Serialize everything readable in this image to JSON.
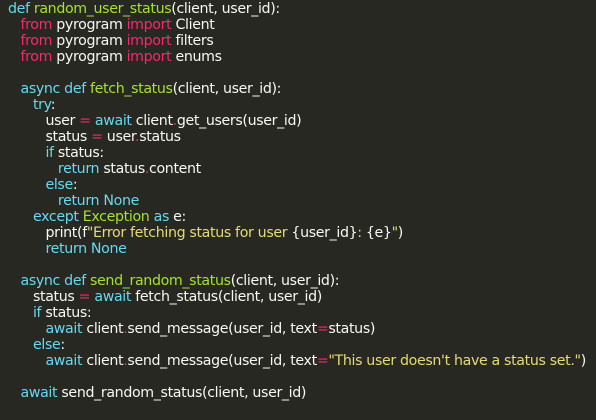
{
  "colors": {
    "background": "#272822",
    "plain": "#f8f8f2",
    "keyword": "#66d9ef",
    "import_keyword": "#f92672",
    "function_name": "#a6e22e",
    "operator": "#f92672",
    "string": "#e6db74"
  },
  "code": {
    "lines": [
      [
        [
          "kw",
          "def "
        ],
        [
          "fn",
          "random_user_status"
        ],
        [
          "plain",
          "(client, user_id):"
        ]
      ],
      [
        [
          "plain",
          "   "
        ],
        [
          "imp",
          "from"
        ],
        [
          "plain",
          " pyrogram "
        ],
        [
          "imp",
          "import"
        ],
        [
          "plain",
          " Client"
        ]
      ],
      [
        [
          "plain",
          "   "
        ],
        [
          "imp",
          "from"
        ],
        [
          "plain",
          " pyrogram "
        ],
        [
          "imp",
          "import"
        ],
        [
          "plain",
          " filters"
        ]
      ],
      [
        [
          "plain",
          "   "
        ],
        [
          "imp",
          "from"
        ],
        [
          "plain",
          " pyrogram "
        ],
        [
          "imp",
          "import"
        ],
        [
          "plain",
          " enums"
        ]
      ],
      [],
      [
        [
          "plain",
          "   "
        ],
        [
          "kw",
          "async def "
        ],
        [
          "fn",
          "fetch_status"
        ],
        [
          "plain",
          "(client, user_id):"
        ]
      ],
      [
        [
          "plain",
          "      "
        ],
        [
          "kw",
          "try"
        ],
        [
          "plain",
          ":"
        ]
      ],
      [
        [
          "plain",
          "         user "
        ],
        [
          "op",
          "="
        ],
        [
          "plain",
          " "
        ],
        [
          "kw",
          "await"
        ],
        [
          "plain",
          " client"
        ],
        [
          "op",
          "."
        ],
        [
          "plain",
          "get_users(user_id)"
        ]
      ],
      [
        [
          "plain",
          "         status "
        ],
        [
          "op",
          "="
        ],
        [
          "plain",
          " user"
        ],
        [
          "op",
          "."
        ],
        [
          "plain",
          "status"
        ]
      ],
      [
        [
          "plain",
          "         "
        ],
        [
          "kw",
          "if"
        ],
        [
          "plain",
          " status:"
        ]
      ],
      [
        [
          "plain",
          "            "
        ],
        [
          "kw",
          "return"
        ],
        [
          "plain",
          " status"
        ],
        [
          "op",
          "."
        ],
        [
          "plain",
          "content"
        ]
      ],
      [
        [
          "plain",
          "         "
        ],
        [
          "kw",
          "else"
        ],
        [
          "plain",
          ":"
        ]
      ],
      [
        [
          "plain",
          "            "
        ],
        [
          "kw",
          "return None"
        ]
      ],
      [
        [
          "plain",
          "      "
        ],
        [
          "kw",
          "except"
        ],
        [
          "plain",
          " "
        ],
        [
          "fn",
          "Exception"
        ],
        [
          "plain",
          " "
        ],
        [
          "kw",
          "as"
        ],
        [
          "plain",
          " e:"
        ]
      ],
      [
        [
          "plain",
          "         print(f"
        ],
        [
          "str",
          "\"Error fetching status for user "
        ],
        [
          "plain",
          "{user_id}"
        ],
        [
          "str",
          ": "
        ],
        [
          "plain",
          "{e}"
        ],
        [
          "str",
          "\""
        ],
        [
          "plain",
          ")"
        ]
      ],
      [
        [
          "plain",
          "         "
        ],
        [
          "kw",
          "return None"
        ]
      ],
      [],
      [
        [
          "plain",
          "   "
        ],
        [
          "kw",
          "async def "
        ],
        [
          "fn",
          "send_random_status"
        ],
        [
          "plain",
          "(client, user_id):"
        ]
      ],
      [
        [
          "plain",
          "      status "
        ],
        [
          "op",
          "="
        ],
        [
          "plain",
          " "
        ],
        [
          "kw",
          "await"
        ],
        [
          "plain",
          " fetch_status(client, user_id)"
        ]
      ],
      [
        [
          "plain",
          "      "
        ],
        [
          "kw",
          "if"
        ],
        [
          "plain",
          " status:"
        ]
      ],
      [
        [
          "plain",
          "         "
        ],
        [
          "kw",
          "await"
        ],
        [
          "plain",
          " client"
        ],
        [
          "op",
          "."
        ],
        [
          "plain",
          "send_message(user_id, text"
        ],
        [
          "op",
          "="
        ],
        [
          "plain",
          "status)"
        ]
      ],
      [
        [
          "plain",
          "      "
        ],
        [
          "kw",
          "else"
        ],
        [
          "plain",
          ":"
        ]
      ],
      [
        [
          "plain",
          "         "
        ],
        [
          "kw",
          "await"
        ],
        [
          "plain",
          " client"
        ],
        [
          "op",
          "."
        ],
        [
          "plain",
          "send_message(user_id, text"
        ],
        [
          "op",
          "="
        ],
        [
          "str",
          "\"This user doesn't have a status set.\""
        ],
        [
          "plain",
          ")"
        ]
      ],
      [],
      [
        [
          "plain",
          "   "
        ],
        [
          "kw",
          "await"
        ],
        [
          "plain",
          " send_random_status(client, user_id)"
        ]
      ]
    ]
  }
}
